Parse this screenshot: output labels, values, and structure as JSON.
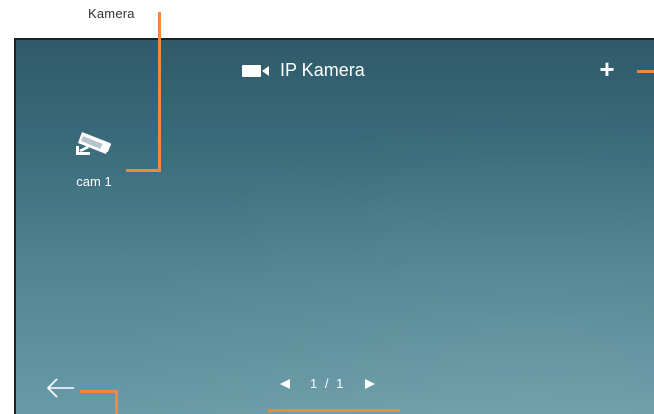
{
  "callouts": {
    "top_caption": "Kamera"
  },
  "header": {
    "title": "IP Kamera",
    "title_icon": "video-camera-icon",
    "add_label": "+"
  },
  "cameras": [
    {
      "label": "cam 1",
      "icon": "security-camera-icon"
    }
  ],
  "footer": {
    "back_icon": "back-arrow-icon",
    "page_indicator": "1 / 1",
    "prev_icon": "triangle-left-icon",
    "next_icon": "triangle-right-icon"
  },
  "colors": {
    "accent": "#f08a3a",
    "screen_top": "#2f5a6a",
    "screen_bottom": "#6a9ca8",
    "text": "#ffffff"
  }
}
